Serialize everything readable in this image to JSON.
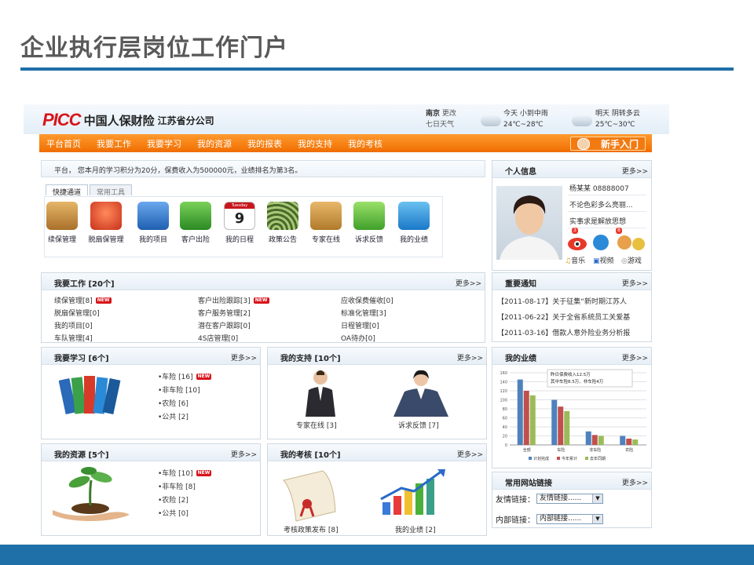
{
  "slide": {
    "title": "企业执行层岗位工作门户"
  },
  "header": {
    "logo_text": "PICC",
    "company_name": "中国人保财险",
    "branch_name": "江苏省分公司",
    "city": "南京",
    "change_link": "更改",
    "seven_day_link": "七日天气",
    "today_label": "今天 小到中雨",
    "today_temp": "24℃~28℃",
    "tomorrow_label": "明天 阴转多云",
    "tomorrow_temp": "25℃~30℃"
  },
  "nav": {
    "items": [
      "平台首页",
      "我要工作",
      "我要学习",
      "我的资源",
      "我的报表",
      "我的支持",
      "我的考核"
    ],
    "newbie_button": "新手入门"
  },
  "notice_bar": {
    "text": "平台，  您本月的学习积分为20分，保费收入为500000元，业绩排名为第3名。"
  },
  "quick_tabs": {
    "tabs": [
      "快捷通道",
      "常用工具"
    ],
    "active": "快捷通道",
    "items": [
      {
        "label": "续保管理",
        "icon": "renewal-icon",
        "color": "#c8903a"
      },
      {
        "label": "脱扇保管理",
        "icon": "alarm-icon",
        "color": "#e0502a"
      },
      {
        "label": "我的项目",
        "icon": "folder-icon",
        "color": "#2f73c8"
      },
      {
        "label": "客户出险",
        "icon": "runner-icon",
        "color": "#3aa02e"
      },
      {
        "label": "我的日程",
        "icon": "calendar-icon",
        "color": "#c8161d",
        "day_number": "9",
        "day_name": "Tuesday"
      },
      {
        "label": "政策公告",
        "icon": "audio-icon",
        "color": "#5c8a3a"
      },
      {
        "label": "专家在线",
        "icon": "contacts-icon",
        "color": "#b87a2a"
      },
      {
        "label": "诉求反馈",
        "icon": "phone-icon",
        "color": "#5cb82e"
      },
      {
        "label": "我的业绩",
        "icon": "stocks-icon",
        "color": "#2a8ad8"
      }
    ]
  },
  "work": {
    "title": "我要工作 [20个]",
    "more": "更多>>",
    "columns": [
      [
        {
          "text": "续保管理[8]",
          "new": true
        },
        {
          "text": "脱扇保管理[0]"
        },
        {
          "text": "我的项目[0]"
        },
        {
          "text": "车队管理[4]"
        }
      ],
      [
        {
          "text": "客户出险跟踪[3]",
          "new": true
        },
        {
          "text": "客户服务管理[2]"
        },
        {
          "text": "潜在客户跟踪[0]"
        },
        {
          "text": "4S店管理[0]"
        }
      ],
      [
        {
          "text": "应收保费催收[0]"
        },
        {
          "text": "标准化管理[3]"
        },
        {
          "text": "日程管理[0]"
        },
        {
          "text": "OA待办[0]"
        }
      ]
    ],
    "new_badge": "NEW"
  },
  "study": {
    "title": "我要学习 [6个]",
    "more": "更多>>",
    "items": [
      {
        "text": "•车险 [16]",
        "new": true
      },
      {
        "text": "•非车险 [10]"
      },
      {
        "text": "•农险 [6]"
      },
      {
        "text": "•公共 [2]"
      }
    ]
  },
  "support": {
    "title": "我的支持 [10个]",
    "more": "更多>>",
    "captions": [
      "专家在线 [3]",
      "诉求反馈 [7]"
    ]
  },
  "resources": {
    "title": "我的资源 [5个]",
    "more": "更多>>",
    "items": [
      {
        "text": "•车险 [10]",
        "new": true
      },
      {
        "text": "•非车险 [8]"
      },
      {
        "text": "•农险 [2]"
      },
      {
        "text": "•公共 [0]"
      }
    ]
  },
  "exam": {
    "title": "我的考核 [10个]",
    "more": "更多>>",
    "captions": [
      "考核政策发布 [8]",
      "我的业绩 [2]"
    ]
  },
  "profile": {
    "title": "个人信息",
    "more": "更多>>",
    "name_line": "杨某某  08888007",
    "motto1": "不论色彩多么亮丽...",
    "motto2": "实事求是解放思想",
    "links": [
      "音乐",
      "视频",
      "游戏"
    ],
    "badges": [
      "3",
      "8"
    ]
  },
  "notices": {
    "title": "重要通知",
    "more": "更多>>",
    "items": [
      "【2011-08-17】关于征集“新时期江苏人",
      "【2011-06-22】关于全省系统员工关爱基",
      "【2011-03-16】借款人意外险业务分析报"
    ]
  },
  "performance": {
    "title": "我的业绩",
    "more": "更多>>"
  },
  "chart_data": {
    "type": "bar",
    "categories": [
      "全部",
      "车险",
      "非车险",
      "农险"
    ],
    "series": [
      {
        "name": "计划完成",
        "values": [
          145,
          100,
          30,
          20
        ],
        "color": "#4f81bd"
      },
      {
        "name": "今年累计",
        "values": [
          120,
          85,
          22,
          14
        ],
        "color": "#c0504d"
      },
      {
        "name": "去年同期",
        "values": [
          110,
          75,
          20,
          12
        ],
        "color": "#9bbb59"
      }
    ],
    "yticks": [
      "0",
      "20",
      "40",
      "60",
      "80",
      "100",
      "120",
      "140",
      "160"
    ],
    "ylim": [
      0,
      160
    ],
    "annotations": [
      "昨日保费收入12.5万",
      "其中车险8.5万、非车险4万"
    ],
    "legend_position": "bottom"
  },
  "links_box": {
    "title": "常用网站链接",
    "more": "更多>>",
    "rows": [
      {
        "label": "友情链接：",
        "value": "友情链接......"
      },
      {
        "label": "内部链接：",
        "value": "内部链接......"
      }
    ]
  }
}
